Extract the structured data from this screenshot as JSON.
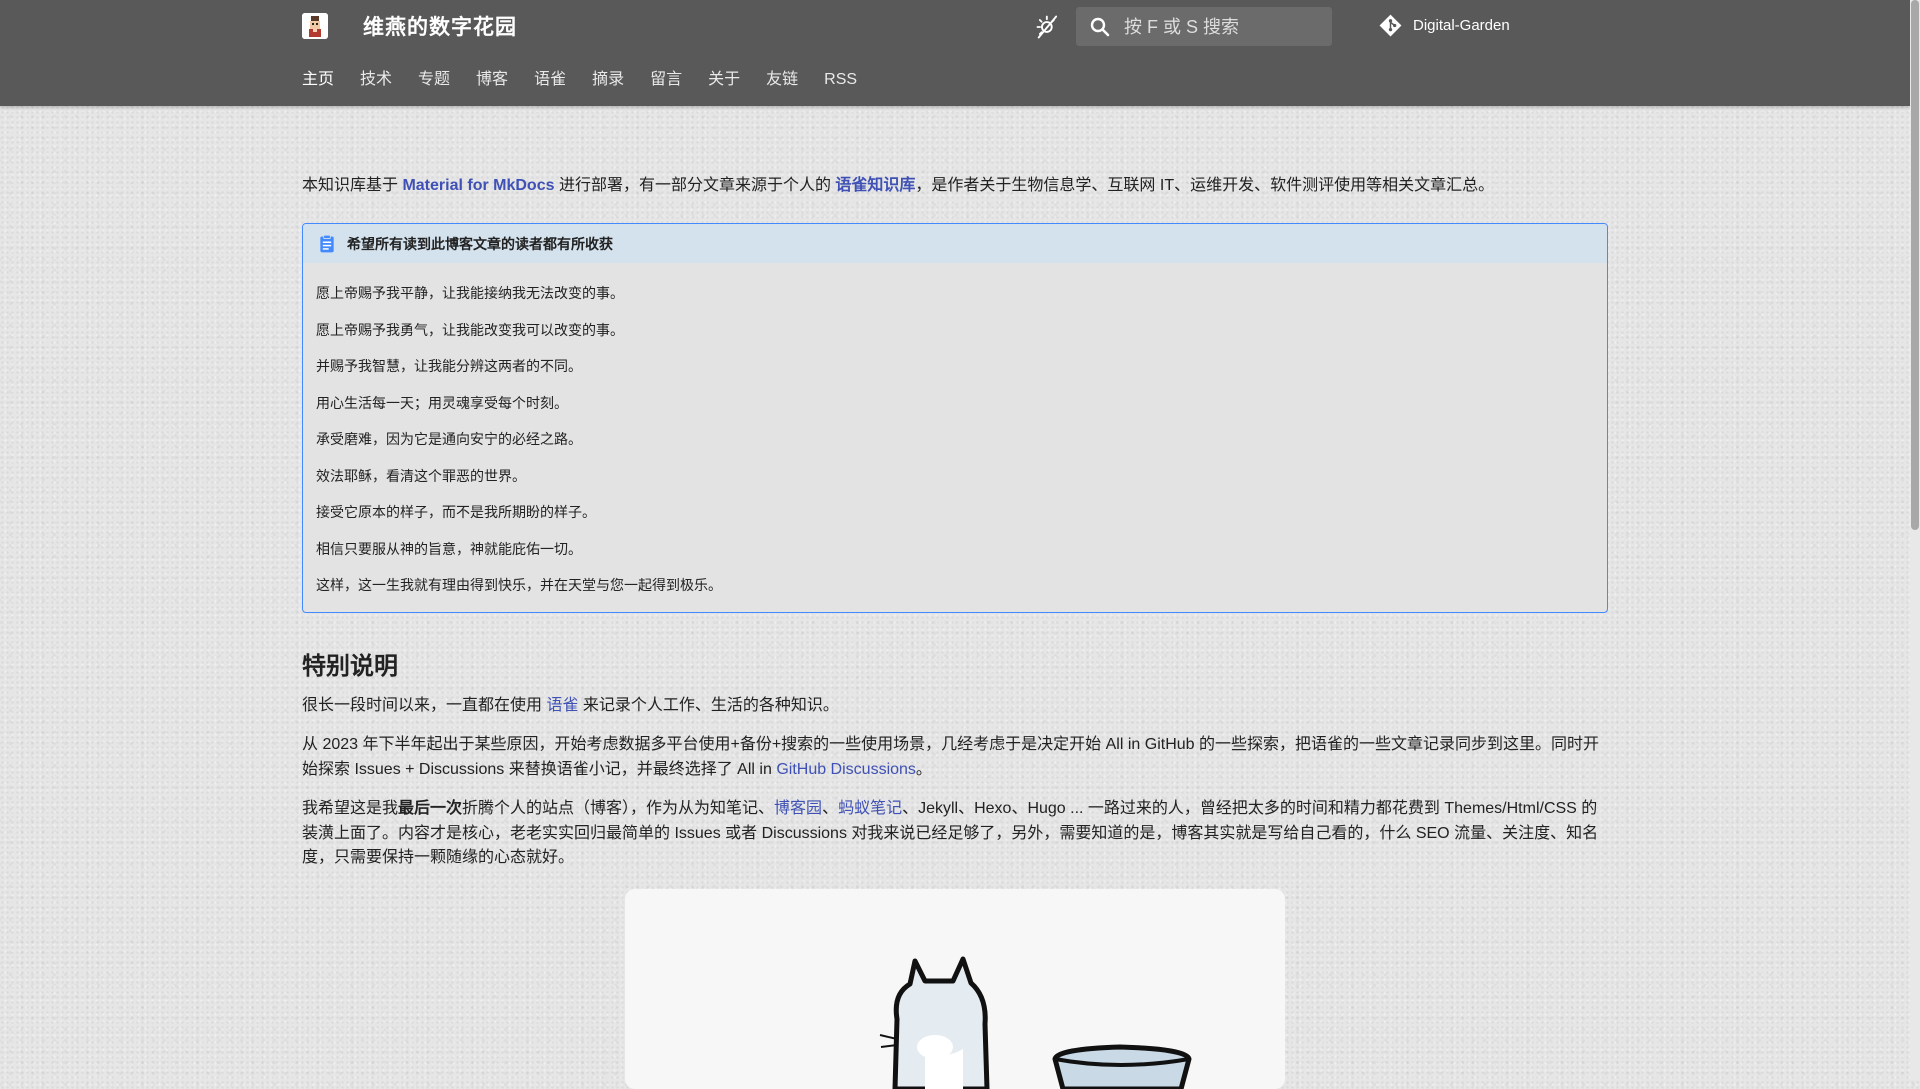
{
  "header": {
    "site_title": "维燕的数字花园",
    "search_placeholder": "按 F 或 S 搜索",
    "repo_name": "Digital-Garden",
    "icons": {
      "logo": "avatar-logo",
      "theme": "brightness-auto-icon",
      "search": "search-icon",
      "repo": "git-icon"
    }
  },
  "nav": {
    "items": [
      {
        "label": "主页"
      },
      {
        "label": "技术"
      },
      {
        "label": "专题"
      },
      {
        "label": "博客"
      },
      {
        "label": "语雀"
      },
      {
        "label": "摘录"
      },
      {
        "label": "留言"
      },
      {
        "label": "关于"
      },
      {
        "label": "友链"
      },
      {
        "label": "RSS"
      }
    ]
  },
  "intro": {
    "t1": "本知识库基于 ",
    "link1": "Material for MkDocs",
    "t2": " 进行部署，有一部分文章来源于个人的 ",
    "link2": "语雀知识库",
    "t3": "，是作者关于生物信息学、互联网 IT、运维开发、软件测评使用等相关文章汇总。"
  },
  "admonition": {
    "title": "希望所有读到此博客文章的读者都有所收获",
    "lines": [
      "愿上帝赐予我平静，让我能接纳我无法改变的事。",
      "愿上帝赐予我勇气，让我能改变我可以改变的事。",
      "并赐予我智慧，让我能分辨这两者的不同。",
      "用心生活每一天；用灵魂享受每个时刻。",
      "承受磨难，因为它是通向安宁的必经之路。",
      "效法耶稣，看清这个罪恶的世界。",
      "接受它原本的样子，而不是我所期盼的样子。",
      "相信只要服从神的旨意，神就能庇佑一切。",
      "这样，这一生我就有理由得到快乐，并在天堂与您一起得到极乐。"
    ]
  },
  "section": {
    "heading": "特别说明",
    "p1_a": "很长一段时间以来，一直都在使用 ",
    "p1_link": "语雀",
    "p1_b": " 来记录个人工作、生活的各种知识。",
    "p2_a": "从 2023 年下半年起出于某些原因，开始考虑数据多平台使用+备份+搜索的一些使用场景，几经考虑于是决定开始 All in GitHub 的一些探索，把语雀的一些文章记录同步到这里。同时开始探索 Issues + Discussions 来替换语雀小记，并最终选择了 All in ",
    "p2_link": "GitHub Discussions",
    "p2_b": "。",
    "p3_a": "我希望这是我",
    "p3_bold": "最后一次",
    "p3_b": "折腾个人的站点（博客），作为从为知笔记、",
    "p3_link1": "博客园",
    "p3_sep": "、",
    "p3_link2": "蚂蚁笔记",
    "p3_c": "、Jekyll、Hexo、Hugo ... 一路过来的人，曾经把太多的时间和精力都花费到 Themes/Html/CSS 的装潢上面了。内容才是核心，老老实实回归最简单的 Issues 或者 Discussions 对我来说已经足够了，另外，需要知道的是，博客其实就是写给自己看的，什么 SEO 流量、关注度、知名度，只需要保持一颗随缘的心态就好。"
  },
  "colors": {
    "header_bg": "#595959",
    "link": "#3f51b5",
    "admonition_border": "#448aff",
    "admonition_title_bg": "#d4e2ee"
  }
}
